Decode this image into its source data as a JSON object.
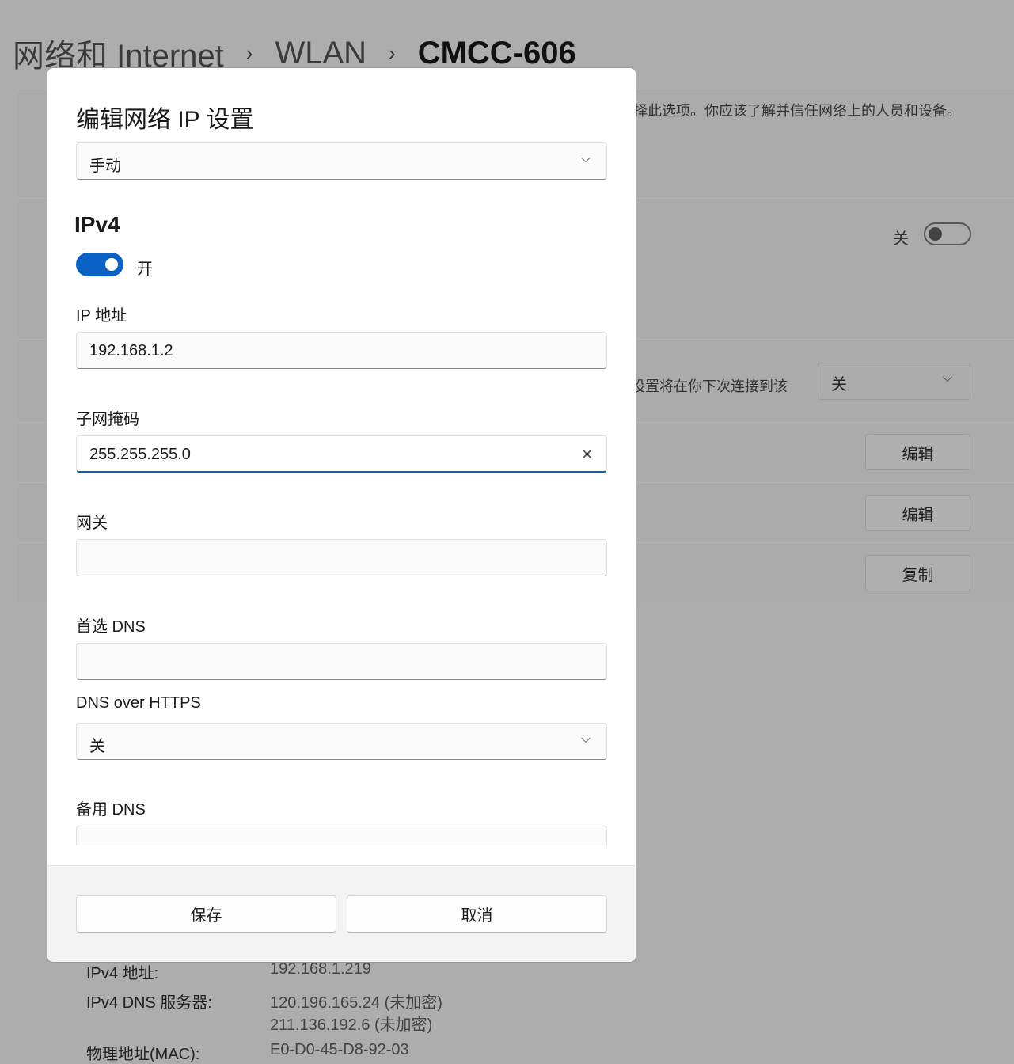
{
  "breadcrumb": [
    "网络和 Internet",
    "WLAN",
    "CMCC-606"
  ],
  "background": {
    "description_text": "择此选项。你应该了解并信任网络上的人员和设备。",
    "toggle_label": "关",
    "toggle_state": "off",
    "setting_text": "设置将在你下次连接到该",
    "select_value": "关",
    "buttons": [
      "编辑",
      "编辑",
      "复制"
    ],
    "properties": [
      {
        "label": "IPv4 地址:",
        "values": [
          "192.168.1.219"
        ]
      },
      {
        "label": "IPv4 DNS 服务器:",
        "values": [
          "120.196.165.24 (未加密)",
          "211.136.192.6 (未加密)"
        ]
      },
      {
        "label": "物理地址(MAC):",
        "values": [
          "E0-D0-45-D8-92-03"
        ]
      }
    ]
  },
  "dialog": {
    "title": "编辑网络 IP 设置",
    "mode": "手动",
    "ipv4_heading": "IPv4",
    "ipv4_toggle_label": "开",
    "ipv4_toggle_state": "on",
    "ip_label": "IP 地址",
    "ip_value": "192.168.1.2",
    "subnet_label": "子网掩码",
    "subnet_value": "255.255.255.0",
    "gateway_label": "网关",
    "gateway_value": "",
    "dns_label": "首选 DNS",
    "dns_value": "",
    "doh_label": "DNS over HTTPS",
    "doh_value": "关",
    "alt_dns_label": "备用 DNS",
    "save": "保存",
    "cancel": "取消"
  },
  "colors": {
    "accent": "#0a63c4"
  }
}
